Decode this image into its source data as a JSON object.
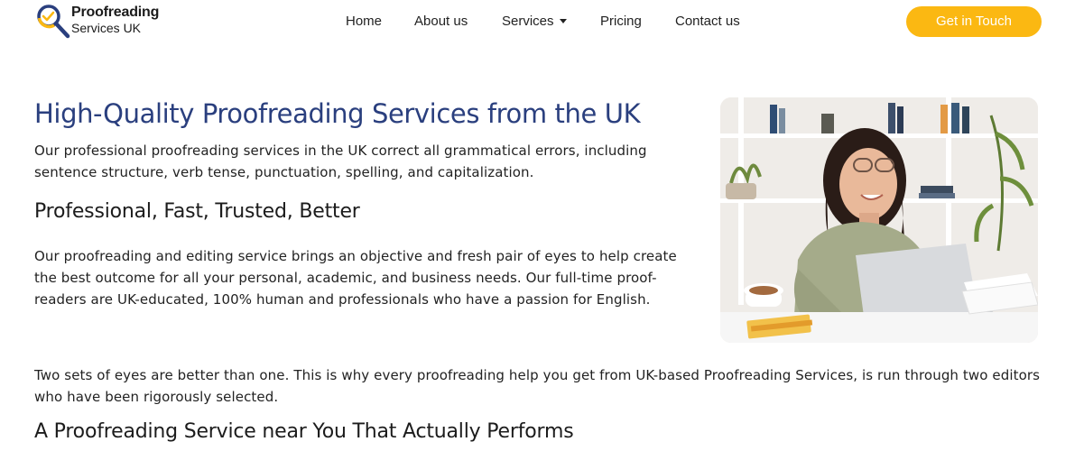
{
  "brand": {
    "name_line1": "Proofreading",
    "name_line2": "Services UK",
    "accent_color": "#fbb812",
    "title_color": "#2a3f7e",
    "logo_icon": "magnifier-icon"
  },
  "nav": {
    "items": [
      {
        "label": "Home"
      },
      {
        "label": "About us"
      },
      {
        "label": "Services",
        "has_dropdown": true
      },
      {
        "label": "Pricing"
      },
      {
        "label": "Contact us"
      }
    ],
    "cta_label": "Get in Touch"
  },
  "content": {
    "title": "High-Quality Proofreading Services from the UK",
    "intro": "Our professional proofreading services in the UK correct all grammatical errors, including sentence structure, verb tense, punctuation, spelling, and capitalization.",
    "heading1": "Professional, Fast, Trusted, Better",
    "body1": "Our proofreading and editing service brings an objective and fresh pair of eyes to help create the best outcome for all your personal, academic, and business needs. Our full-time proof-readers are UK-educated, 100% human and professionals who have a passion for English.",
    "body2": "Two sets of eyes are better than one. This is why every proofreading help you get from UK-based Proofreading Services, is run through two editors who have been rigorously selected.",
    "heading2": "A Proofreading Service near You That Actually Performs"
  },
  "photo": {
    "subject": "woman-with-laptop-photo"
  }
}
